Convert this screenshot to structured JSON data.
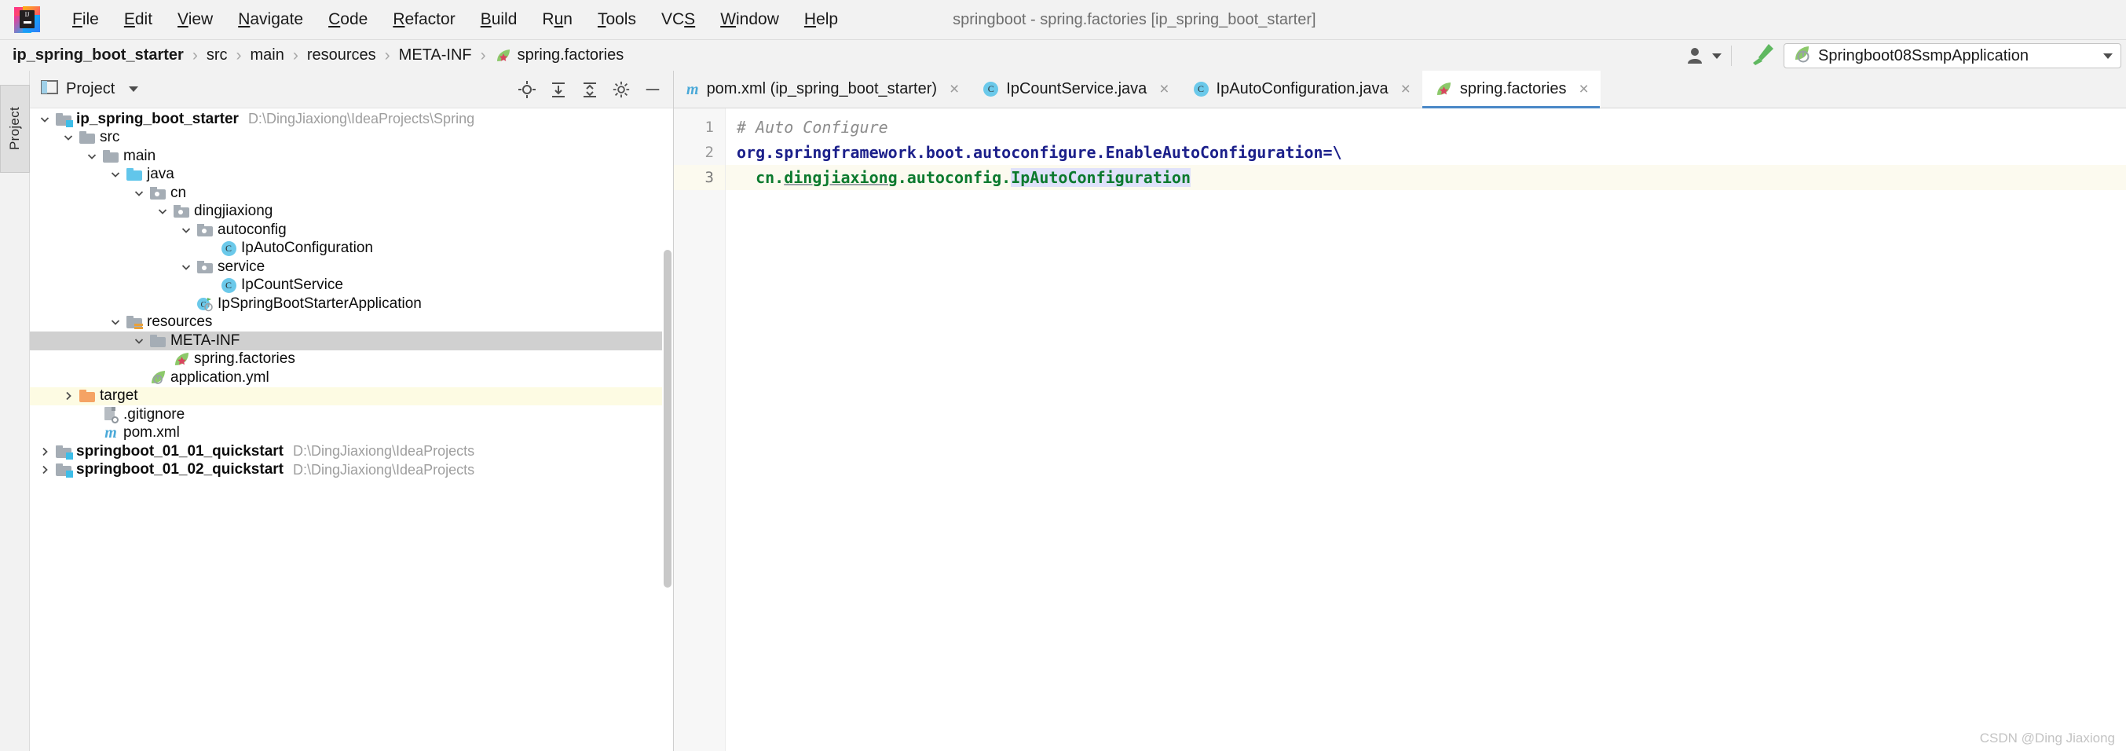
{
  "window": {
    "title": "springboot - spring.factories [ip_spring_boot_starter]"
  },
  "menu": {
    "items": [
      {
        "label": "File",
        "mnemonic": "F"
      },
      {
        "label": "Edit",
        "mnemonic": "E"
      },
      {
        "label": "View",
        "mnemonic": "V"
      },
      {
        "label": "Navigate",
        "mnemonic": "N"
      },
      {
        "label": "Code",
        "mnemonic": "C"
      },
      {
        "label": "Refactor",
        "mnemonic": "R"
      },
      {
        "label": "Build",
        "mnemonic": "B"
      },
      {
        "label": "Run",
        "mnemonic": "u"
      },
      {
        "label": "Tools",
        "mnemonic": "T"
      },
      {
        "label": "VCS",
        "mnemonic": "S"
      },
      {
        "label": "Window",
        "mnemonic": "W"
      },
      {
        "label": "Help",
        "mnemonic": "H"
      }
    ]
  },
  "breadcrumb": {
    "separator": "›",
    "items": [
      {
        "label": "ip_spring_boot_starter",
        "bold": true,
        "icon": ""
      },
      {
        "label": "src",
        "bold": false,
        "icon": ""
      },
      {
        "label": "main",
        "bold": false,
        "icon": ""
      },
      {
        "label": "resources",
        "bold": false,
        "icon": ""
      },
      {
        "label": "META-INF",
        "bold": false,
        "icon": ""
      },
      {
        "label": "spring.factories",
        "bold": false,
        "icon": "spring-leaf-icon"
      }
    ]
  },
  "toolbar": {
    "user_icon": "user-silhouette-icon",
    "build_icon": "hammer-icon",
    "run_config": {
      "icon": "spring-boot-run-icon",
      "label": "Springboot08SsmpApplication"
    }
  },
  "tool_strip": {
    "project_button": "Project"
  },
  "project_panel": {
    "icon": "project-window-icon",
    "title": "Project",
    "actions": [
      {
        "name": "locate-icon"
      },
      {
        "name": "expand-all-icon"
      },
      {
        "name": "collapse-all-icon"
      },
      {
        "name": "settings-gear-icon"
      },
      {
        "name": "hide-minus-icon"
      }
    ]
  },
  "tree": {
    "nodes": [
      {
        "label": "ip_spring_boot_starter",
        "path": "D:\\DingJiaxiong\\IdeaProjects\\Spring",
        "indent": 0,
        "arrow": "down",
        "icon": "module-folder-icon",
        "bold": true,
        "state": "none"
      },
      {
        "label": "src",
        "path": "",
        "indent": 1,
        "arrow": "down",
        "icon": "folder-gray-icon",
        "bold": false,
        "state": "none"
      },
      {
        "label": "main",
        "path": "",
        "indent": 2,
        "arrow": "down",
        "icon": "folder-gray-icon",
        "bold": false,
        "state": "none"
      },
      {
        "label": "java",
        "path": "",
        "indent": 3,
        "arrow": "down",
        "icon": "folder-sources-icon",
        "bold": false,
        "state": "none"
      },
      {
        "label": "cn",
        "path": "",
        "indent": 4,
        "arrow": "down",
        "icon": "package-icon",
        "bold": false,
        "state": "none"
      },
      {
        "label": "dingjiaxiong",
        "path": "",
        "indent": 5,
        "arrow": "down",
        "icon": "package-icon",
        "bold": false,
        "state": "none"
      },
      {
        "label": "autoconfig",
        "path": "",
        "indent": 6,
        "arrow": "down",
        "icon": "package-icon",
        "bold": false,
        "state": "none"
      },
      {
        "label": "IpAutoConfiguration",
        "path": "",
        "indent": 7,
        "arrow": "none",
        "icon": "java-class-icon",
        "bold": false,
        "state": "none"
      },
      {
        "label": "service",
        "path": "",
        "indent": 6,
        "arrow": "down",
        "icon": "package-icon",
        "bold": false,
        "state": "none"
      },
      {
        "label": "IpCountService",
        "path": "",
        "indent": 7,
        "arrow": "none",
        "icon": "java-class-icon",
        "bold": false,
        "state": "none"
      },
      {
        "label": "IpSpringBootStarterApplication",
        "path": "",
        "indent": 6,
        "arrow": "none",
        "icon": "spring-boot-class-icon",
        "bold": false,
        "state": "none"
      },
      {
        "label": "resources",
        "path": "",
        "indent": 3,
        "arrow": "down",
        "icon": "folder-resources-icon",
        "bold": false,
        "state": "none"
      },
      {
        "label": "META-INF",
        "path": "",
        "indent": 4,
        "arrow": "down",
        "icon": "folder-gray-icon",
        "bold": false,
        "state": "selected"
      },
      {
        "label": "spring.factories",
        "path": "",
        "indent": 5,
        "arrow": "none",
        "icon": "spring-factories-icon",
        "bold": false,
        "state": "none"
      },
      {
        "label": "application.yml",
        "path": "",
        "indent": 4,
        "arrow": "none",
        "icon": "spring-yaml-icon",
        "bold": false,
        "state": "none"
      },
      {
        "label": "target",
        "path": "",
        "indent": 1,
        "arrow": "right",
        "icon": "folder-excluded-icon",
        "bold": false,
        "state": "highlighted"
      },
      {
        "label": ".gitignore",
        "path": "",
        "indent": 2,
        "arrow": "none",
        "icon": "gitignore-icon",
        "bold": false,
        "state": "none"
      },
      {
        "label": "pom.xml",
        "path": "",
        "indent": 2,
        "arrow": "none",
        "icon": "maven-icon",
        "bold": false,
        "state": "none"
      },
      {
        "label": "springboot_01_01_quickstart",
        "path": "D:\\DingJiaxiong\\IdeaProjects",
        "indent": 0,
        "arrow": "right",
        "icon": "module-folder-icon",
        "bold": true,
        "state": "none"
      },
      {
        "label": "springboot_01_02_quickstart",
        "path": "D:\\DingJiaxiong\\IdeaProjects",
        "indent": 0,
        "arrow": "right",
        "icon": "module-folder-icon",
        "bold": true,
        "state": "none"
      }
    ]
  },
  "editor_tabs": [
    {
      "label": "pom.xml (ip_spring_boot_starter)",
      "icon": "maven-icon",
      "active": false,
      "close": "×"
    },
    {
      "label": "IpCountService.java",
      "icon": "java-class-icon",
      "active": false,
      "close": "×"
    },
    {
      "label": "IpAutoConfiguration.java",
      "icon": "java-class-icon",
      "active": false,
      "close": "×"
    },
    {
      "label": "spring.factories",
      "icon": "spring-factories-icon",
      "active": true,
      "close": "×"
    }
  ],
  "editor": {
    "lines": [
      {
        "number": "1",
        "current": false,
        "segments": [
          {
            "text": "# Auto Configure",
            "style": "comment"
          }
        ]
      },
      {
        "number": "2",
        "current": false,
        "segments": [
          {
            "text": "org.springframework.boot.autoconfigure.EnableAutoConfiguration=\\",
            "style": "key"
          }
        ]
      },
      {
        "number": "3",
        "current": true,
        "segments": [
          {
            "text": "  cn.",
            "style": "val"
          },
          {
            "text": "dingjiaxiong",
            "style": "val-underline"
          },
          {
            "text": ".autoconfig.",
            "style": "val"
          },
          {
            "text": "IpAutoConfiguration",
            "style": "val-highlight"
          }
        ]
      }
    ]
  },
  "watermark": "CSDN @Ding Jiaxiong",
  "colors": {
    "accent_tab": "#4a88c7",
    "selection_gray": "#d0d0d0",
    "highlight_yellow": "#fdfbe3",
    "code_key": "#1b1f8a",
    "code_value": "#0c7a2e",
    "code_comment": "#8c8c8c",
    "class_icon": "#6bc9ea",
    "spring_green": "#6db33f"
  }
}
